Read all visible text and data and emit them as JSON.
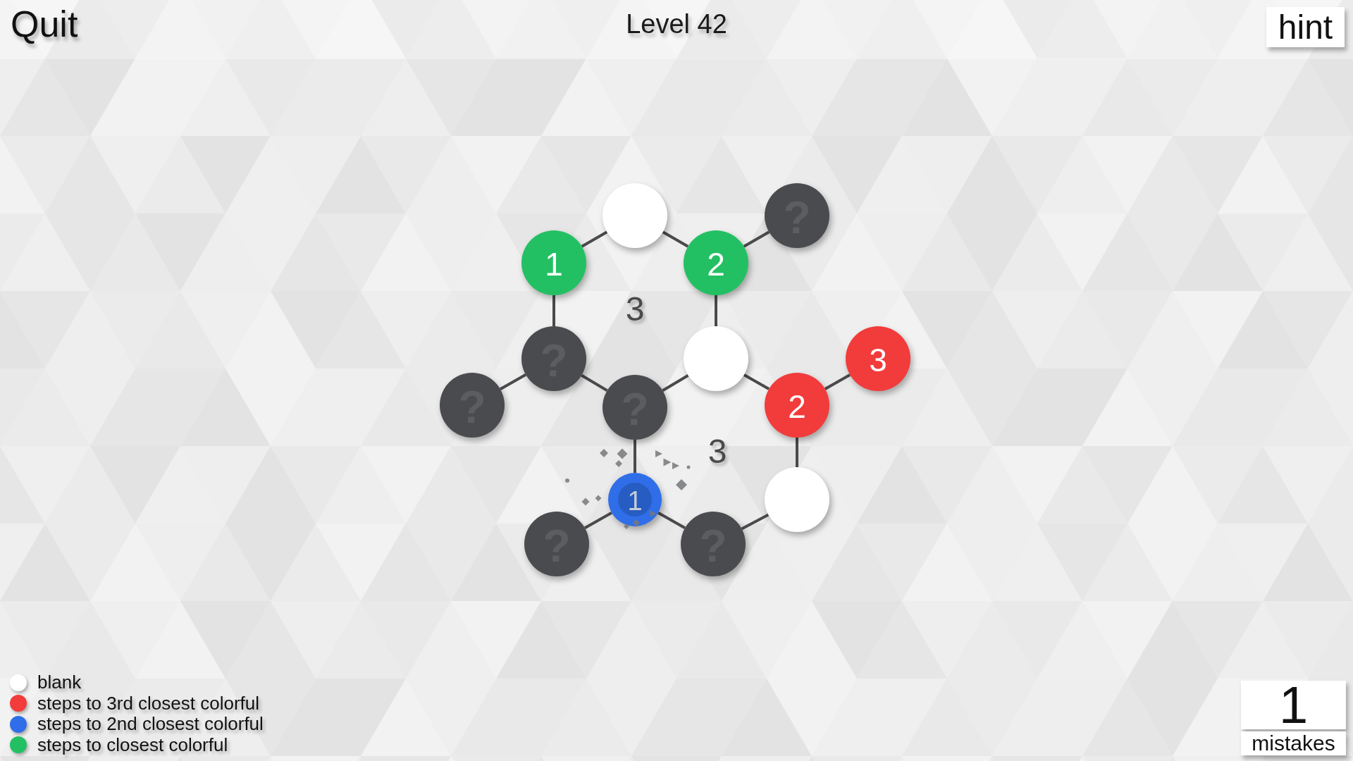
{
  "header": {
    "quit_button": "Quit",
    "level_title": "Level 42",
    "hint_button": "hint"
  },
  "graph": {
    "nodes": [
      {
        "kind": "blank",
        "just_revealed": false
      },
      {
        "kind": "unknown",
        "symbol": "?",
        "just_revealed": false
      },
      {
        "kind": "colorful",
        "color": "#23c063",
        "number": "1",
        "just_revealed": false
      },
      {
        "kind": "colorful",
        "color": "#23c063",
        "number": "2",
        "just_revealed": false
      },
      {
        "kind": "unknown",
        "symbol": "?",
        "just_revealed": false
      },
      {
        "kind": "blank",
        "just_revealed": false
      },
      {
        "kind": "colorful",
        "color": "#f23b3b",
        "number": "3",
        "just_revealed": false
      },
      {
        "kind": "unknown",
        "symbol": "?",
        "just_revealed": false
      },
      {
        "kind": "unknown",
        "symbol": "?",
        "just_revealed": false
      },
      {
        "kind": "colorful",
        "color": "#f23b3b",
        "number": "2",
        "just_revealed": false
      },
      {
        "kind": "colorful",
        "color": "#2f6ee8",
        "number": "1",
        "just_revealed": true
      },
      {
        "kind": "blank",
        "just_revealed": false
      },
      {
        "kind": "unknown",
        "symbol": "?",
        "just_revealed": false
      },
      {
        "kind": "unknown",
        "symbol": "?",
        "just_revealed": false
      }
    ],
    "region_clues": [
      {
        "text": "3"
      },
      {
        "text": "3"
      }
    ]
  },
  "legend": {
    "items": [
      {
        "label": "blank",
        "color": "#ffffff"
      },
      {
        "label": "steps to 3rd closest colorful",
        "color": "#f23b3b"
      },
      {
        "label": "steps to 2nd closest colorful",
        "color": "#2f6ee8"
      },
      {
        "label": "steps to closest colorful",
        "color": "#23c063"
      }
    ]
  },
  "mistakes": {
    "count": "1",
    "label": "mistakes"
  }
}
